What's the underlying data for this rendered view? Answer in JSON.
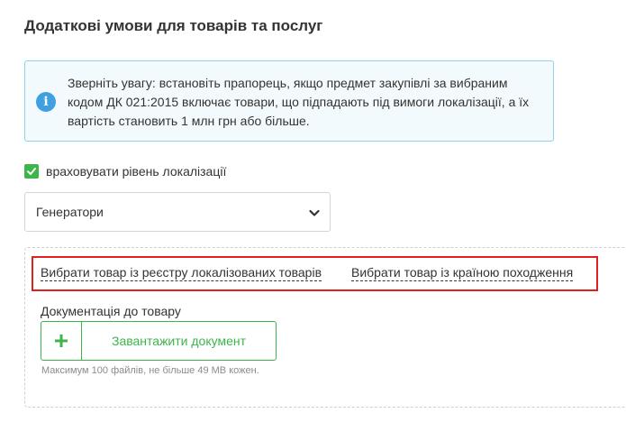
{
  "section": {
    "title": "Додаткові умови для товарів та послуг"
  },
  "notice": {
    "icon": "info-icon",
    "text": "Зверніть увагу: встановіть прапорець, якщо предмет закупівлі за вибраним кодом ДК 021:2015 включає товари, що підпадають під вимоги локалізації, а їх вартість становить 1 млн грн або більше."
  },
  "localization_checkbox": {
    "label": "враховувати рівень локалізації",
    "checked": true
  },
  "category_select": {
    "value": "Генератори"
  },
  "links": {
    "registry": "Вибрати товар із реєстру локалізованих товарів",
    "origin": "Вибрати товар із країною походження"
  },
  "documentation": {
    "label": "Документація до товару",
    "upload_label": "Завантажити документ",
    "hint": "Максимум 100 файлів, не більше 49 MB кожен."
  },
  "colors": {
    "accent_green": "#3db54a",
    "info_blue": "#3f9fe0",
    "highlight_red": "#e02020"
  }
}
